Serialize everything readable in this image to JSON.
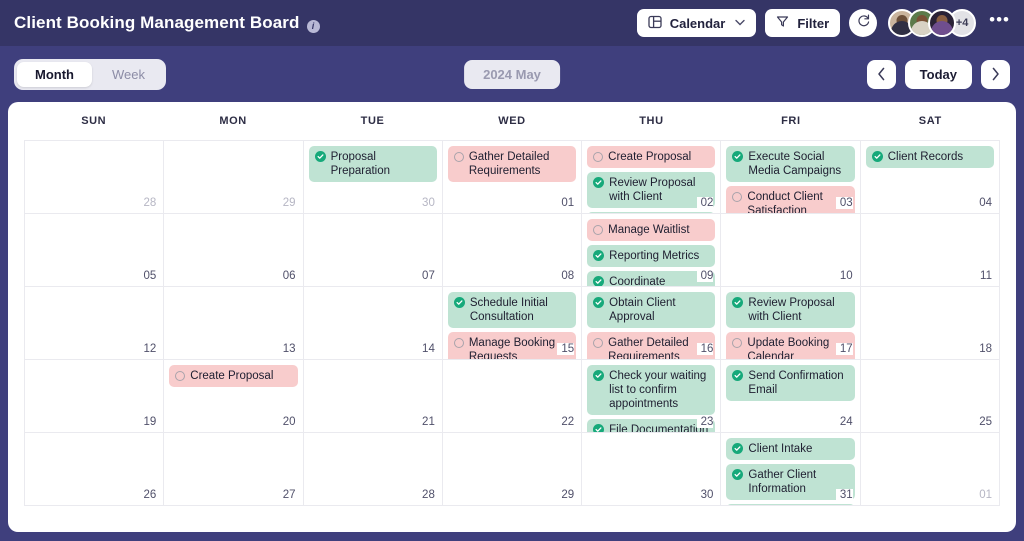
{
  "header": {
    "title": "Client Booking Management Board",
    "info_icon": "info-icon",
    "view_button": {
      "label": "Calendar",
      "icon": "layout-board-icon",
      "chevron": "chevron-down-icon"
    },
    "filter_button": {
      "label": "Filter",
      "icon": "funnel-icon"
    },
    "refresh_button": {
      "icon": "refresh-icon"
    },
    "avatars_overflow": "+4",
    "more_menu": "•••"
  },
  "controls": {
    "view_modes": [
      {
        "label": "Month",
        "active": true
      },
      {
        "label": "Week",
        "active": false
      }
    ],
    "period_label": "2024 May",
    "prev_label": "‹",
    "today_label": "Today",
    "next_label": "›"
  },
  "calendar": {
    "day_headers": [
      "SUN",
      "MON",
      "TUE",
      "WED",
      "THU",
      "FRI",
      "SAT"
    ],
    "weeks": [
      [
        {
          "day": "28",
          "muted": true,
          "events": []
        },
        {
          "day": "29",
          "muted": true,
          "events": []
        },
        {
          "day": "30",
          "muted": true,
          "events": [
            {
              "title": "Proposal Preparation",
              "status": "done"
            }
          ]
        },
        {
          "day": "01",
          "muted": false,
          "events": [
            {
              "title": "Gather Detailed Requirements",
              "status": "todo"
            }
          ]
        },
        {
          "day": "02",
          "muted": false,
          "events": [
            {
              "title": "Create Proposal",
              "status": "todo"
            },
            {
              "title": "Review Proposal with Client",
              "status": "done"
            },
            {
              "title": "",
              "status": "done"
            }
          ]
        },
        {
          "day": "03",
          "muted": false,
          "events": [
            {
              "title": "Execute Social Media Campaigns",
              "status": "done"
            },
            {
              "title": "Conduct Client Satisfaction Surveys",
              "status": "todo"
            }
          ]
        },
        {
          "day": "04",
          "muted": false,
          "events": [
            {
              "title": "Client Records",
              "status": "done"
            }
          ]
        }
      ],
      [
        {
          "day": "05",
          "muted": false,
          "events": []
        },
        {
          "day": "06",
          "muted": false,
          "events": []
        },
        {
          "day": "07",
          "muted": false,
          "events": []
        },
        {
          "day": "08",
          "muted": false,
          "events": []
        },
        {
          "day": "09",
          "muted": false,
          "events": [
            {
              "title": "Manage Waitlist",
              "status": "todo"
            },
            {
              "title": "Reporting Metrics",
              "status": "done"
            },
            {
              "title": "Coordinate",
              "status": "done"
            }
          ]
        },
        {
          "day": "10",
          "muted": false,
          "events": []
        },
        {
          "day": "11",
          "muted": false,
          "events": []
        }
      ],
      [
        {
          "day": "12",
          "muted": false,
          "events": []
        },
        {
          "day": "13",
          "muted": false,
          "events": []
        },
        {
          "day": "14",
          "muted": false,
          "events": []
        },
        {
          "day": "15",
          "muted": false,
          "events": [
            {
              "title": "Schedule Initial Consultation",
              "status": "done"
            },
            {
              "title": "Manage Booking Requests",
              "status": "todo"
            }
          ]
        },
        {
          "day": "16",
          "muted": false,
          "events": [
            {
              "title": "Obtain Client Approval",
              "status": "done"
            },
            {
              "title": "Gather Detailed Requirements",
              "status": "todo"
            }
          ]
        },
        {
          "day": "17",
          "muted": false,
          "events": [
            {
              "title": "Review Proposal with Client",
              "status": "done"
            },
            {
              "title": "Update Booking Calendar",
              "status": "todo"
            }
          ]
        },
        {
          "day": "18",
          "muted": false,
          "events": []
        }
      ],
      [
        {
          "day": "19",
          "muted": false,
          "events": []
        },
        {
          "day": "20",
          "muted": false,
          "events": [
            {
              "title": "Create Proposal",
              "status": "todo"
            }
          ]
        },
        {
          "day": "21",
          "muted": false,
          "events": []
        },
        {
          "day": "22",
          "muted": false,
          "events": []
        },
        {
          "day": "23",
          "muted": false,
          "events": [
            {
              "title": "Check your waiting list to confirm appointments",
              "status": "done"
            },
            {
              "title": "File Documentation",
              "status": "done"
            }
          ]
        },
        {
          "day": "24",
          "muted": false,
          "events": [
            {
              "title": "Send Confirmation Email",
              "status": "done"
            }
          ]
        },
        {
          "day": "25",
          "muted": false,
          "events": []
        }
      ],
      [
        {
          "day": "26",
          "muted": false,
          "events": []
        },
        {
          "day": "27",
          "muted": false,
          "events": []
        },
        {
          "day": "28",
          "muted": false,
          "events": []
        },
        {
          "day": "29",
          "muted": false,
          "events": []
        },
        {
          "day": "30",
          "muted": false,
          "events": []
        },
        {
          "day": "31",
          "muted": false,
          "events": [
            {
              "title": "Client Intake",
              "status": "done"
            },
            {
              "title": "Gather Client Information",
              "status": "done"
            },
            {
              "title": "",
              "status": "done"
            }
          ]
        },
        {
          "day": "01",
          "muted": true,
          "events": []
        }
      ]
    ]
  },
  "colors": {
    "brand_purple": "#3f3f7d",
    "topbar_purple": "#353566",
    "event_done_bg": "#bfe3d3",
    "event_todo_bg": "#f8cccc",
    "check_green": "#16a97a"
  }
}
